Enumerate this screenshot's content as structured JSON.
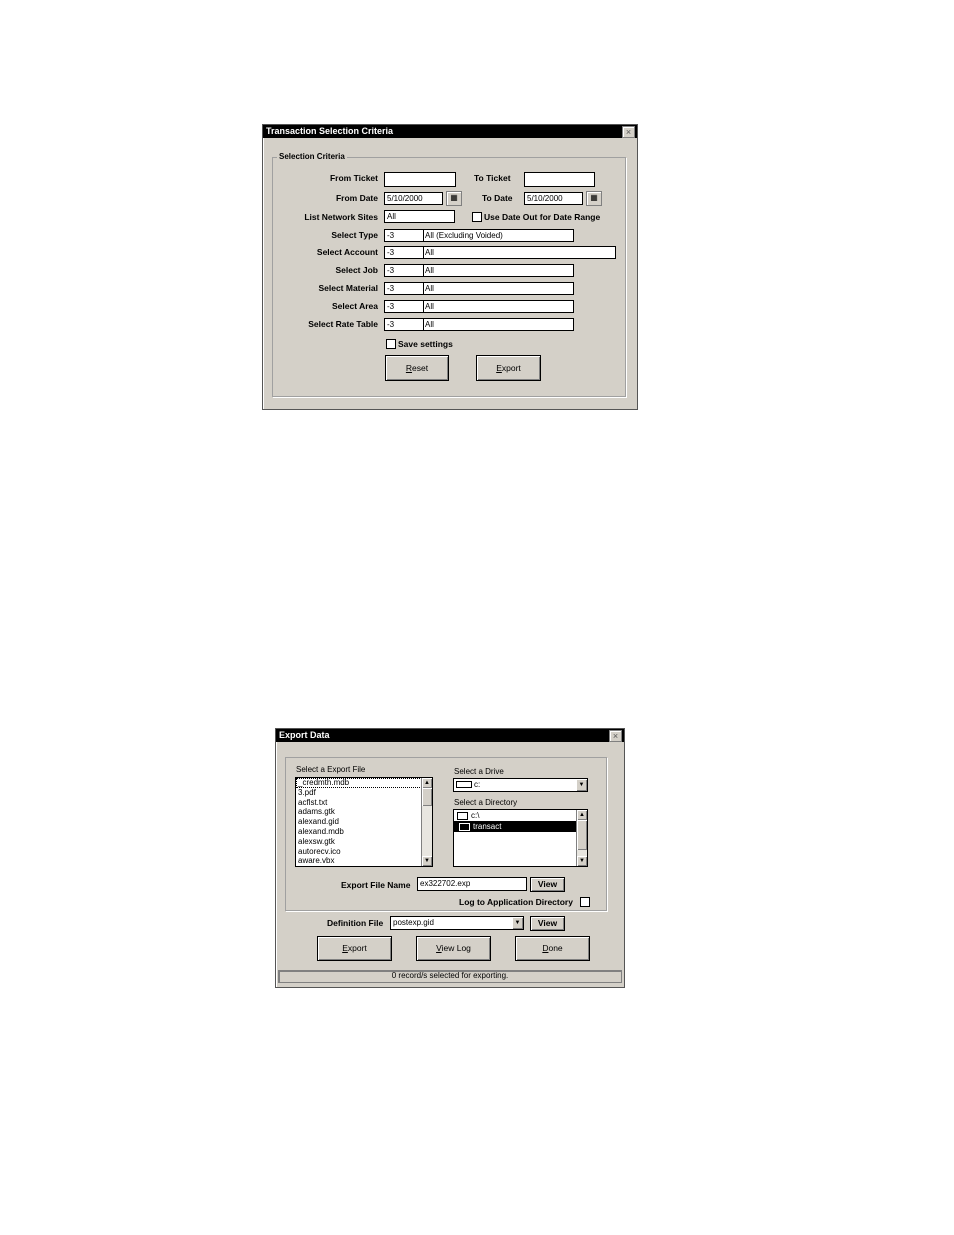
{
  "transaction": {
    "title": "Transaction Selection Criteria",
    "close_glyph": "×",
    "group_label": "Selection Criteria",
    "from_ticket_label": "From Ticket",
    "from_ticket_value": "",
    "to_ticket_label": "To Ticket",
    "to_ticket_value": "",
    "from_date_label": "From Date",
    "from_date_value": "5/10/2000",
    "to_date_label": "To Date",
    "to_date_value": "5/10/2000",
    "calendar_glyph": "▦",
    "list_network_sites_label": "List Network Sites",
    "list_network_sites_value": "All",
    "use_date_out_label": "Use Date Out for Date Range",
    "use_date_out_checked": false,
    "select_type": {
      "label": "Select Type",
      "code": "-3",
      "desc": "All (Excluding Voided)"
    },
    "select_account": {
      "label": "Select Account",
      "code": "-3",
      "desc": "All"
    },
    "select_job": {
      "label": "Select Job",
      "code": "-3",
      "desc": "All"
    },
    "select_material": {
      "label": "Select Material",
      "code": "-3",
      "desc": "All"
    },
    "select_area": {
      "label": "Select Area",
      "code": "-3",
      "desc": "All"
    },
    "select_rate_table": {
      "label": "Select Rate Table",
      "code": "-3",
      "desc": "All"
    },
    "save_settings_label": "Save settings",
    "save_settings_checked": false,
    "reset_mnemonic": "R",
    "reset_rest": "eset",
    "export_mnemonic": "E",
    "export_rest": "xport"
  },
  "export": {
    "title": "Export Data",
    "close_glyph": "×",
    "select_file_label": "Select a Export File",
    "files": [
      "_credmth.mdb",
      "3.pdf",
      "acflst.txt",
      "adams.gtk",
      "alexand.gid",
      "alexand.mdb",
      "alexsw.gtk",
      "autorecv.ico",
      "aware.vbx"
    ],
    "select_drive_label": "Select a Drive",
    "drive_value": "c:",
    "select_directory_label": "Select a Directory",
    "directories": [
      "c:\\",
      "transact"
    ],
    "export_file_name_label": "Export File Name",
    "export_file_name_value": "ex322702.exp",
    "view_label": "View",
    "log_to_app_dir_label": "Log to Application Directory",
    "log_to_app_dir_checked": false,
    "definition_file_label": "Definition File",
    "definition_file_value": "postexp.gid",
    "export_mnemonic": "E",
    "export_rest": "xport",
    "viewlog_mnemonic": "V",
    "viewlog_rest": "iew Log",
    "done_mnemonic": "D",
    "done_rest": "one",
    "status_text": "0 record/s selected for exporting.",
    "arrow_up": "▲",
    "arrow_down": "▼"
  }
}
